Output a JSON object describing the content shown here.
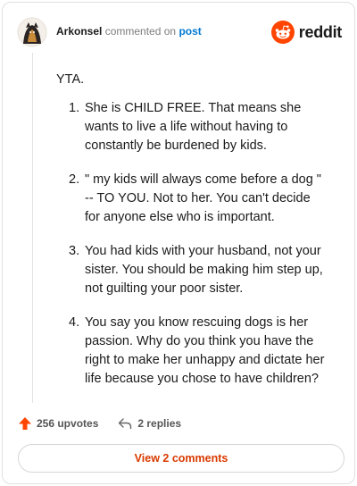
{
  "header": {
    "author": "Arkonsel",
    "verb": "commented on",
    "target": "post",
    "logo_text": "reddit",
    "colors": {
      "brand": "#ff4500",
      "link": "#0079d3"
    }
  },
  "comment": {
    "intro": "YTA.",
    "items": [
      {
        "num": "1.",
        "text": "She is CHILD FREE. That means she wants to live a life without having to constantly be burdened by kids."
      },
      {
        "num": "2.",
        "text": "\" my kids will always come before a dog \" -- TO YOU. Not to her. You can't decide for anyone else who is important."
      },
      {
        "num": "3.",
        "text": "You had kids with your husband, not your sister. You should be making him step up, not guilting your poor sister."
      },
      {
        "num": "4.",
        "text": "You say you know rescuing dogs is her passion. Why do you think you have the right to make her unhappy and dictate her life because you chose to have children?"
      }
    ]
  },
  "actions": {
    "upvotes": "256 upvotes",
    "replies": "2 replies",
    "upvote_icon": "upvote-arrow-icon",
    "reply_icon": "reply-arrow-icon"
  },
  "footer": {
    "view_comments": "View 2 comments",
    "accent": "#d93a00"
  }
}
